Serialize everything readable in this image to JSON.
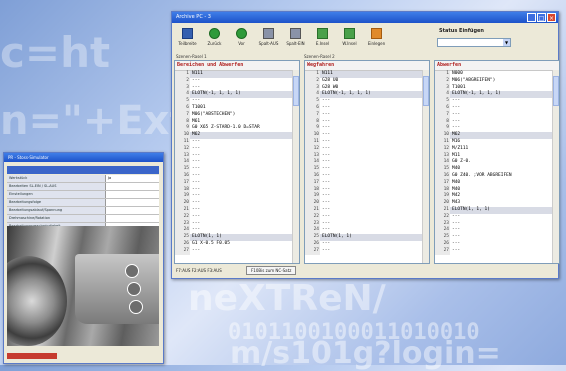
{
  "main_window": {
    "title": "Archive PC - 3",
    "toolbar": [
      {
        "label": "Teilbreite",
        "icon": "blue"
      },
      {
        "label": "Zurück",
        "icon": "circle"
      },
      {
        "label": "Vor",
        "icon": "circle"
      },
      {
        "label": "Spalt-AUS",
        "icon": "sq"
      },
      {
        "label": "Spalt-EIN",
        "icon": "sq"
      },
      {
        "label": "E.Insel",
        "icon": "green"
      },
      {
        "label": "W.Insel",
        "icon": "green"
      },
      {
        "label": "Einlegen",
        "icon": "orange"
      }
    ],
    "status_label": "Status Einfügen",
    "subheaders": [
      "Szenen-Rasel 1",
      "Szenen-Rasel 2"
    ],
    "panels": [
      {
        "header": "Bereichen und Abwerfen",
        "lines": [
          {
            "n": "1",
            "t": "N111",
            "hl": true
          },
          {
            "n": "2",
            "t": "---",
            "hl": false
          },
          {
            "n": "3",
            "t": "---",
            "hl": false
          },
          {
            "n": "4",
            "t": "ELOTN(-1, 1, 1, 1)",
            "hl": true
          },
          {
            "n": "5",
            "t": "---",
            "hl": false
          },
          {
            "n": "6",
            "t": "T1001",
            "hl": false
          },
          {
            "n": "7",
            "t": "M06(\"ABSTECHEN\")",
            "hl": false
          },
          {
            "n": "8",
            "t": "M61",
            "hl": false
          },
          {
            "n": "9",
            "t": "G0 X65 Z-STARD-1.0 D=STAR",
            "hl": false
          },
          {
            "n": "10",
            "t": "M62",
            "hl": true
          },
          {
            "n": "11",
            "t": "---",
            "hl": false
          },
          {
            "n": "12",
            "t": "---",
            "hl": false
          },
          {
            "n": "13",
            "t": "---",
            "hl": false
          },
          {
            "n": "14",
            "t": "---",
            "hl": false
          },
          {
            "n": "15",
            "t": "---",
            "hl": false
          },
          {
            "n": "16",
            "t": "---",
            "hl": false
          },
          {
            "n": "17",
            "t": "---",
            "hl": false
          },
          {
            "n": "18",
            "t": "---",
            "hl": false
          },
          {
            "n": "19",
            "t": "---",
            "hl": false
          },
          {
            "n": "20",
            "t": "---",
            "hl": false
          },
          {
            "n": "21",
            "t": "---",
            "hl": false
          },
          {
            "n": "22",
            "t": "---",
            "hl": false
          },
          {
            "n": "23",
            "t": "---",
            "hl": false
          },
          {
            "n": "24",
            "t": "---",
            "hl": false
          },
          {
            "n": "25",
            "t": "ELOTN(1, 1)",
            "hl": true
          },
          {
            "n": "26",
            "t": "G1 X-0.5 F0.05",
            "hl": false
          },
          {
            "n": "27",
            "t": "---",
            "hl": false
          }
        ]
      },
      {
        "header": "Wegfahren",
        "lines": [
          {
            "n": "1",
            "t": "N111",
            "hl": true
          },
          {
            "n": "2",
            "t": "G28 U0",
            "hl": false
          },
          {
            "n": "3",
            "t": "G28 W0",
            "hl": false
          },
          {
            "n": "4",
            "t": "ELOTN(-1, 1, 1, 1)",
            "hl": true
          },
          {
            "n": "5",
            "t": "---",
            "hl": false
          },
          {
            "n": "6",
            "t": "---",
            "hl": false
          },
          {
            "n": "7",
            "t": "---",
            "hl": false
          },
          {
            "n": "8",
            "t": "---",
            "hl": false
          },
          {
            "n": "9",
            "t": "---",
            "hl": false
          },
          {
            "n": "10",
            "t": "---",
            "hl": false
          },
          {
            "n": "11",
            "t": "---",
            "hl": false
          },
          {
            "n": "12",
            "t": "---",
            "hl": false
          },
          {
            "n": "13",
            "t": "---",
            "hl": false
          },
          {
            "n": "14",
            "t": "---",
            "hl": false
          },
          {
            "n": "15",
            "t": "---",
            "hl": false
          },
          {
            "n": "16",
            "t": "---",
            "hl": false
          },
          {
            "n": "17",
            "t": "---",
            "hl": false
          },
          {
            "n": "18",
            "t": "---",
            "hl": false
          },
          {
            "n": "19",
            "t": "---",
            "hl": false
          },
          {
            "n": "20",
            "t": "---",
            "hl": false
          },
          {
            "n": "21",
            "t": "---",
            "hl": false
          },
          {
            "n": "22",
            "t": "---",
            "hl": false
          },
          {
            "n": "23",
            "t": "---",
            "hl": false
          },
          {
            "n": "24",
            "t": "---",
            "hl": false
          },
          {
            "n": "25",
            "t": "ELOTN(1, 1)",
            "hl": true
          },
          {
            "n": "26",
            "t": "---",
            "hl": false
          },
          {
            "n": "27",
            "t": "---",
            "hl": false
          }
        ]
      },
      {
        "header": "Abwerfen",
        "lines": [
          {
            "n": "1",
            "t": "N000",
            "hl": false
          },
          {
            "n": "2",
            "t": "M06(\"ABGREIFEN\")",
            "hl": false
          },
          {
            "n": "3",
            "t": "T1001",
            "hl": false
          },
          {
            "n": "4",
            "t": "ELOTN(-1, 1, 1, 1)",
            "hl": true
          },
          {
            "n": "5",
            "t": "---",
            "hl": false
          },
          {
            "n": "6",
            "t": "---",
            "hl": false
          },
          {
            "n": "7",
            "t": "---",
            "hl": false
          },
          {
            "n": "8",
            "t": "---",
            "hl": false
          },
          {
            "n": "9",
            "t": "---",
            "hl": false
          },
          {
            "n": "10",
            "t": "M62",
            "hl": true
          },
          {
            "n": "11",
            "t": "M16",
            "hl": false
          },
          {
            "n": "12",
            "t": "M/Z111",
            "hl": false
          },
          {
            "n": "13",
            "t": "M11",
            "hl": false
          },
          {
            "n": "14",
            "t": "G0 Z-0.",
            "hl": false
          },
          {
            "n": "15",
            "t": "M40",
            "hl": false
          },
          {
            "n": "16",
            "t": "G0 Z40. ;VOR ABGREIFEN",
            "hl": false
          },
          {
            "n": "17",
            "t": "M40",
            "hl": false
          },
          {
            "n": "18",
            "t": "M40",
            "hl": false
          },
          {
            "n": "19",
            "t": "M42",
            "hl": false
          },
          {
            "n": "20",
            "t": "M43",
            "hl": false
          },
          {
            "n": "21",
            "t": "ELOTN(1, 1, 1)",
            "hl": true
          },
          {
            "n": "22",
            "t": "---",
            "hl": false
          },
          {
            "n": "23",
            "t": "---",
            "hl": false
          },
          {
            "n": "24",
            "t": "---",
            "hl": false
          },
          {
            "n": "25",
            "t": "---",
            "hl": false
          },
          {
            "n": "26",
            "t": "---",
            "hl": false
          },
          {
            "n": "27",
            "t": "---",
            "hl": false
          }
        ]
      }
    ],
    "status_bar": {
      "left": "F7:AUS  F2:AUS  F3:AUS",
      "right": "F10Bis zum NC-Satz"
    }
  },
  "second_window": {
    "title": "PR - Stoss-Simulator",
    "table_rows": [
      {
        "label": "Werkstück",
        "value": "Ja"
      },
      {
        "label": "Bearbeiten SL-EIN / SL-AUS",
        "value": ""
      },
      {
        "label": "Einstellungen",
        "value": ""
      },
      {
        "label": "Bearbeitungsfolge",
        "value": ""
      },
      {
        "label": "Bearbeitungsablauf/Spannung",
        "value": ""
      },
      {
        "label": "Drehmaschine/Rotation",
        "value": ""
      },
      {
        "label": "Bearbeitungsgeschwindigkeit",
        "value": ""
      }
    ]
  }
}
